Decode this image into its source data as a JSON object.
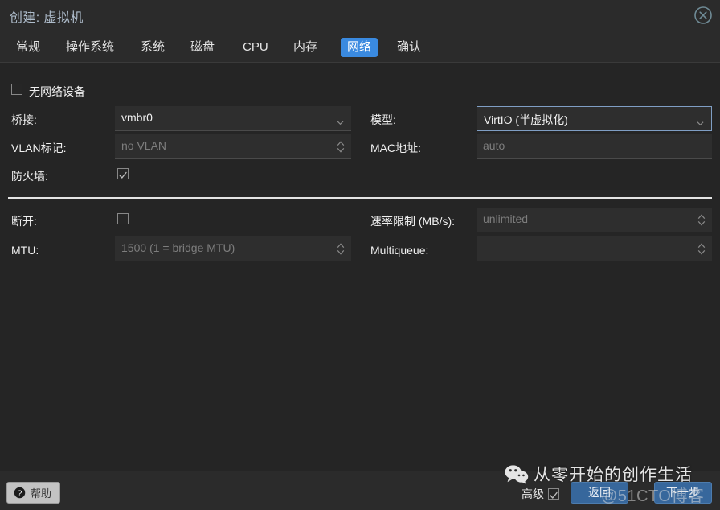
{
  "window": {
    "title": "创建: 虚拟机",
    "close_icon": "close-circle-icon"
  },
  "tabs": [
    {
      "label": "常规",
      "active": false
    },
    {
      "label": "操作系统",
      "active": false
    },
    {
      "label": "系统",
      "active": false
    },
    {
      "label": "磁盘",
      "active": false
    },
    {
      "label": "CPU",
      "active": false
    },
    {
      "label": "内存",
      "active": false
    },
    {
      "label": "网络",
      "active": true
    },
    {
      "label": "确认",
      "active": false
    }
  ],
  "form": {
    "no_network_device": {
      "label": "无网络设备",
      "checked": false
    },
    "left": [
      {
        "label": "桥接:",
        "value": "vmbr0",
        "placeholder": "",
        "control": "combobox",
        "focused": false
      },
      {
        "label": "VLAN标记:",
        "value": "",
        "placeholder": "no VLAN",
        "control": "spinner",
        "focused": false
      }
    ],
    "right": [
      {
        "label": "模型:",
        "value": "VirtIO (半虚拟化)",
        "placeholder": "",
        "control": "combobox",
        "focused": true
      },
      {
        "label": "MAC地址:",
        "value": "",
        "placeholder": "auto",
        "control": "text",
        "focused": false
      }
    ],
    "firewall": {
      "label": "防火墙:",
      "checked": true
    },
    "advanced_left": [
      {
        "label": "断开:",
        "control": "checkbox",
        "checked": false
      },
      {
        "label": "MTU:",
        "value": "",
        "placeholder": "1500 (1 = bridge MTU)",
        "control": "spinner",
        "focused": false
      }
    ],
    "advanced_right": [
      {
        "label": "速率限制 (MB/s):",
        "value": "",
        "placeholder": "unlimited",
        "control": "spinner",
        "focused": false
      },
      {
        "label": "Multiqueue:",
        "value": "",
        "placeholder": "",
        "control": "spinner",
        "focused": false
      }
    ]
  },
  "footer": {
    "help_label": "帮助",
    "help_icon": "question-circle-icon",
    "advanced_label": "高级",
    "advanced_checked": true,
    "back_label": "返回",
    "next_label": "下一步"
  },
  "watermarks": {
    "wechat_text": "从零开始的创作生活",
    "wechat_icon": "wechat-logo-icon",
    "site_text": "@51CTO博客"
  },
  "colors": {
    "accent": "#3a8ae0",
    "window_bg": "#252525",
    "bar_bg": "#2b2b2b",
    "input_bg": "#2e2e2e",
    "title_fg": "#aebccb",
    "button_blue": "#37679c",
    "divider": "#e4e4e4"
  }
}
